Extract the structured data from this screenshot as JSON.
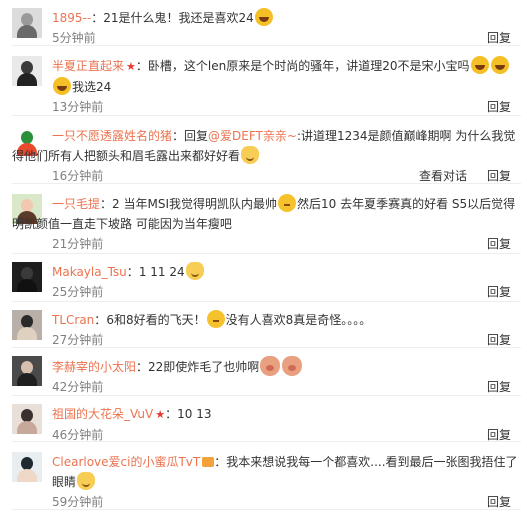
{
  "comments": [
    {
      "username": "1895--",
      "sep": "：",
      "text_1": "21是什么鬼！我还是喜欢24",
      "line2_text": "",
      "time": "5分钟前",
      "reply": "回复",
      "like_icon": "thumbs-up-icon",
      "avatar_colors": [
        "#dcdcdc",
        "#9a9a9a",
        "#6a6a6a"
      ]
    },
    {
      "username": "半夏正直起来",
      "sep": "：",
      "text_1": "卧槽，这个len原来是个时尚的骚年，讲道理20不是宋小宝吗",
      "line2_text": "我选24",
      "time": "13分钟前",
      "reply": "回复",
      "avatar_colors": [
        "#e9e9e9",
        "#3a3a3a",
        "#222222"
      ]
    },
    {
      "username": "一只不愿透露姓名的猪",
      "sep": "：回复",
      "reply_target": "@爱DEFT亲亲~",
      "text_1": ":讲道理1234是颜值巅峰期啊 为什么我觉",
      "line2_text": "得他们所有人把额头和眉毛露出来都好好看",
      "time": "16分钟前",
      "view_dialog": "查看对话",
      "reply": "回复",
      "avatar_colors": [
        "#ffffff",
        "#2c8f3a",
        "#e84a2e"
      ]
    },
    {
      "username": "一只毛提",
      "sep": "：",
      "text_1": "2 当年MSI我觉得明凯队内最帅",
      "text_1b": "然后10 去年夏季赛真的好看 S5以后觉得",
      "line2_text": "明凯颜值一直走下坡路 可能因为当年瘦吧",
      "time": "21分钟前",
      "reply": "回复",
      "avatar_colors": [
        "#d9e8c8",
        "#f2c8b0",
        "#5a3a2a"
      ]
    },
    {
      "username": "Makayla_Tsu",
      "sep": "：",
      "text_1": "1 11 24",
      "line2_text": "",
      "time": "25分钟前",
      "reply": "回复",
      "avatar_colors": [
        "#1e1e1e",
        "#3a3a3a",
        "#111111"
      ]
    },
    {
      "username": "TLCran",
      "sep": "：",
      "text_1": "6和8好看的飞天！",
      "text_1b": "没有人喜欢8真是奇怪。。。。",
      "line2_text": "",
      "time": "27分钟前",
      "reply": "回复",
      "avatar_colors": [
        "#b8b0a8",
        "#2a2a2a",
        "#e0d0c0"
      ]
    },
    {
      "username": "李赫宰的小太阳",
      "sep": "：",
      "text_1": "22即使炸毛了也帅啊",
      "line2_text": "",
      "time": "42分钟前",
      "reply": "回复",
      "avatar_colors": [
        "#4a4a4a",
        "#d8c0b0",
        "#202020"
      ]
    },
    {
      "username": "祖国的大花朵_VuV",
      "sep": "：",
      "text_1": "10   13",
      "line2_text": "",
      "time": "46分钟前",
      "reply": "回复",
      "avatar_colors": [
        "#e8e0d8",
        "#3a3030",
        "#c8a898"
      ]
    },
    {
      "username": "Clearlove爱ci的小蜜瓜TvT",
      "sep": "：",
      "text_1": "我本来想说我每一个都喜欢....看到最后一张图我捂住了",
      "line2_text": "眼睛",
      "time": "59分钟前",
      "reply": "回复",
      "avatar_colors": [
        "#e8eef0",
        "#202830",
        "#f0d8c8"
      ]
    }
  ]
}
